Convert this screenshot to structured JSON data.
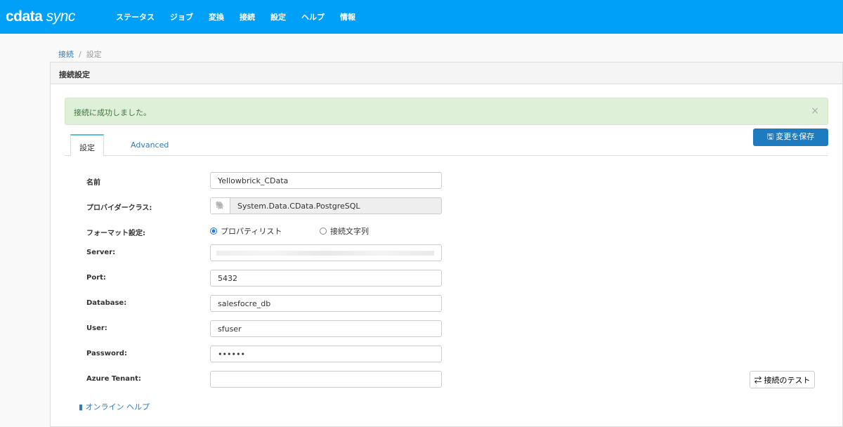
{
  "brand": {
    "logo": "cdata",
    "logo_sub": "sync"
  },
  "nav": [
    "ステータス",
    "ジョブ",
    "変換",
    "接続",
    "設定",
    "ヘルプ",
    "情報"
  ],
  "breadcrumb": {
    "parent": "接続",
    "sep": "/",
    "current": "設定"
  },
  "panel": {
    "title": "接続設定"
  },
  "alert": {
    "message": "接続に成功しました。",
    "close": "×"
  },
  "save_label": "変更を保存",
  "tabs": [
    "設定",
    "Advanced"
  ],
  "form": {
    "name_label": "名前",
    "name": "Yellowbrick_CData",
    "provider_label": "プロバイダークラス:",
    "provider": "System.Data.CData.PostgreSQL",
    "format_label": "フォーマット設定:",
    "format_opt1": "プロパティリスト",
    "format_opt2": "接続文字列",
    "server_label": "Server:",
    "port_label": "Port:",
    "port": "5432",
    "database_label": "Database:",
    "database": "salesfocre_db",
    "user_label": "User:",
    "user": "sfuser",
    "password_label": "Password:",
    "password": "••••••",
    "tenant_label": "Azure Tenant:",
    "tenant": ""
  },
  "test_label": "接続のテスト",
  "help_label": "オンライン ヘルプ"
}
